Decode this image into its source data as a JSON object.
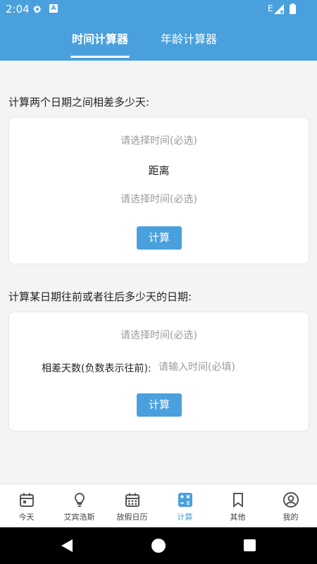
{
  "status_bar": {
    "time": "2:04",
    "network_label": "E"
  },
  "tabs": [
    {
      "label": "时间计算器",
      "active": true
    },
    {
      "label": "年龄计算器",
      "active": false
    }
  ],
  "section1": {
    "title": "计算两个日期之间相差多少天:",
    "start_placeholder": "请选择时间(必选)",
    "distance_label": "距离",
    "end_placeholder": "请选择时间(必选)",
    "button_label": "计算"
  },
  "section2": {
    "title": "计算某日期往前或者往后多少天的日期:",
    "date_placeholder": "请选择时间(必选)",
    "days_label": "相差天数(负数表示往前):",
    "days_placeholder": "请输入时间(必填)",
    "button_label": "计算"
  },
  "bottom_nav": [
    {
      "label": "今天",
      "icon": "calendar-today-icon"
    },
    {
      "label": "艾宾浩斯",
      "icon": "lightbulb-icon"
    },
    {
      "label": "放假日历",
      "icon": "calendar-grid-icon"
    },
    {
      "label": "计算",
      "icon": "calculator-icon",
      "active": true
    },
    {
      "label": "其他",
      "icon": "bookmark-icon"
    },
    {
      "label": "我的",
      "icon": "user-circle-icon"
    }
  ],
  "colors": {
    "primary": "#4aa0dd",
    "background": "#f4f4f4",
    "placeholder": "#9a9a9a"
  }
}
